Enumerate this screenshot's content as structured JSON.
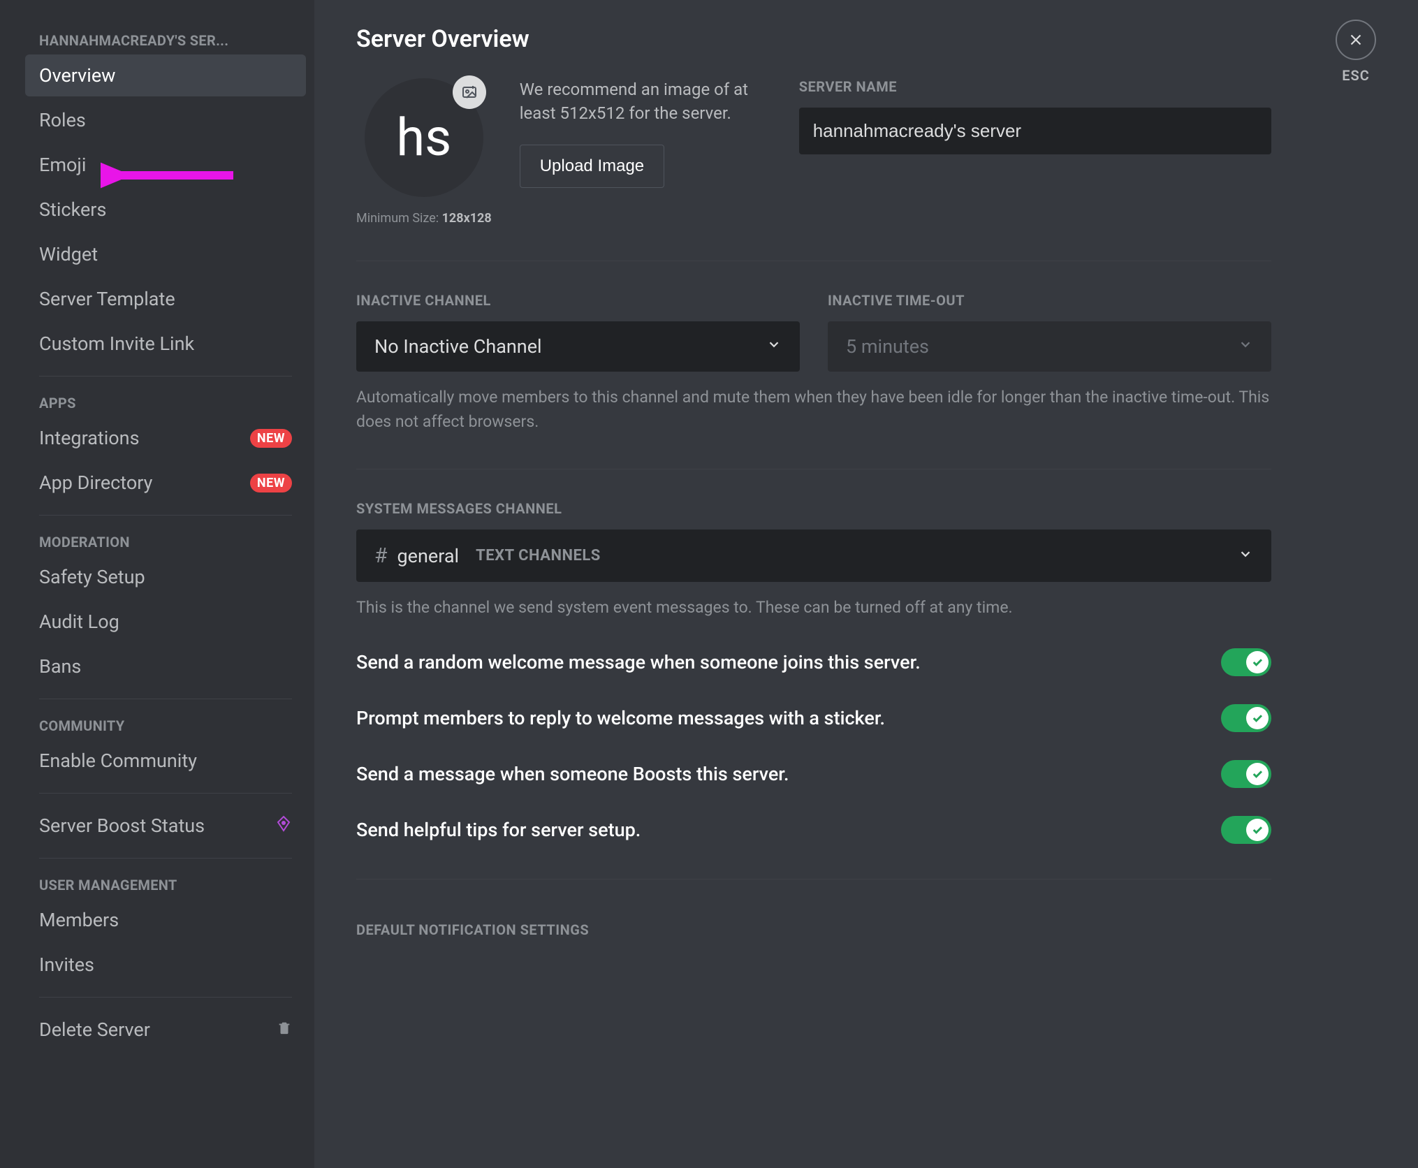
{
  "sidebar": {
    "server_header": "HANNAHMACREADY'S SER...",
    "items_main": [
      {
        "label": "Overview",
        "active": true
      },
      {
        "label": "Roles"
      },
      {
        "label": "Emoji"
      },
      {
        "label": "Stickers"
      },
      {
        "label": "Widget"
      },
      {
        "label": "Server Template"
      },
      {
        "label": "Custom Invite Link"
      }
    ],
    "apps_header": "APPS",
    "items_apps": [
      {
        "label": "Integrations",
        "badge": "NEW"
      },
      {
        "label": "App Directory",
        "badge": "NEW"
      }
    ],
    "moderation_header": "MODERATION",
    "items_moderation": [
      {
        "label": "Safety Setup"
      },
      {
        "label": "Audit Log"
      },
      {
        "label": "Bans"
      }
    ],
    "community_header": "COMMUNITY",
    "items_community": [
      {
        "label": "Enable Community"
      }
    ],
    "boost_label": "Server Boost Status",
    "user_mgmt_header": "USER MANAGEMENT",
    "items_user": [
      {
        "label": "Members"
      },
      {
        "label": "Invites"
      }
    ],
    "delete_label": "Delete Server"
  },
  "close": {
    "esc": "ESC"
  },
  "page": {
    "title": "Server Overview",
    "avatar_initials": "hs",
    "min_size_prefix": "Minimum Size: ",
    "min_size_value": "128x128",
    "recommend": "We recommend an image of at least 512x512 for the server.",
    "upload_btn": "Upload Image",
    "server_name_label": "SERVER NAME",
    "server_name_value": "hannahmacready's server",
    "inactive_channel_label": "INACTIVE CHANNEL",
    "inactive_channel_value": "No Inactive Channel",
    "inactive_timeout_label": "INACTIVE TIME-OUT",
    "inactive_timeout_value": "5 minutes",
    "inactive_help": "Automatically move members to this channel and mute them when they have been idle for longer than the inactive time-out. This does not affect browsers.",
    "system_channel_label": "SYSTEM MESSAGES CHANNEL",
    "system_channel_name": "general",
    "system_channel_category": "TEXT CHANNELS",
    "system_help": "This is the channel we send system event messages to. These can be turned off at any time.",
    "toggles": [
      {
        "label": "Send a random welcome message when someone joins this server.",
        "on": true
      },
      {
        "label": "Prompt members to reply to welcome messages with a sticker.",
        "on": true
      },
      {
        "label": "Send a message when someone Boosts this server.",
        "on": true
      },
      {
        "label": "Send helpful tips for server setup.",
        "on": true
      }
    ],
    "notif_header": "DEFAULT NOTIFICATION SETTINGS"
  }
}
